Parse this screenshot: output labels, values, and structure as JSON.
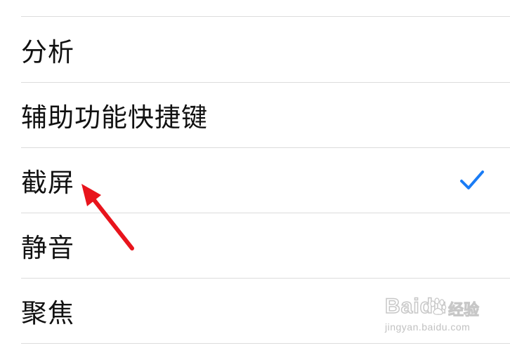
{
  "options": [
    {
      "label": "分析",
      "selected": false
    },
    {
      "label": "辅助功能快捷键",
      "selected": false
    },
    {
      "label": "截屏",
      "selected": true
    },
    {
      "label": "静音",
      "selected": false
    },
    {
      "label": "聚焦",
      "selected": false
    }
  ],
  "check_icon": "checkmark-icon",
  "check_color": "#1a7cf5",
  "annotation_arrow_color": "#e8141c",
  "watermark": {
    "brand": "Baidu",
    "brand_cn": "经验",
    "url": "jingyan.baidu.com"
  }
}
